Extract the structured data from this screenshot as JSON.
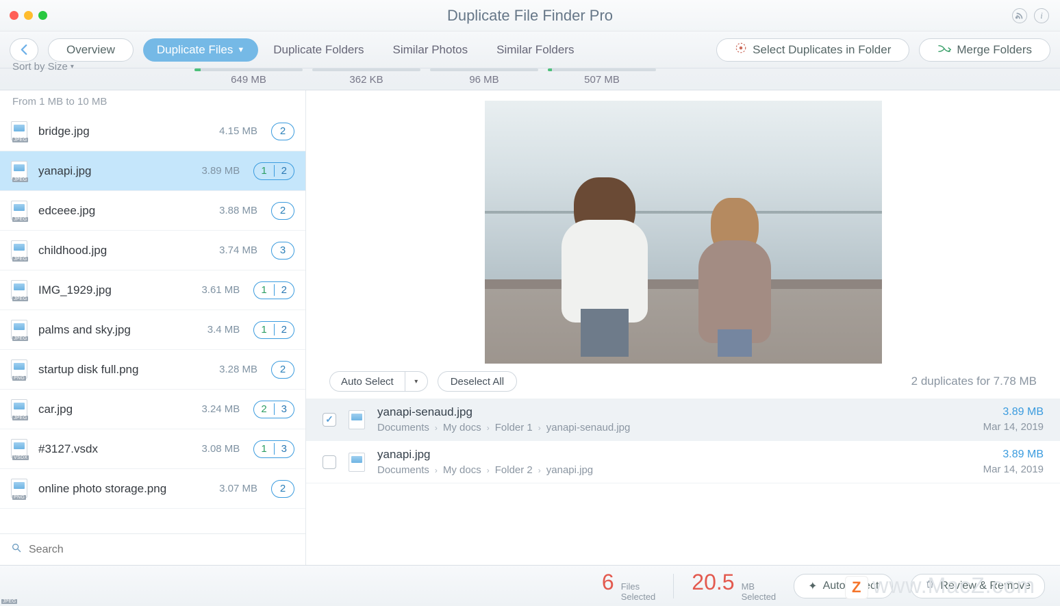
{
  "app": {
    "title": "Duplicate File Finder Pro"
  },
  "toolbar": {
    "overview": "Overview",
    "select_folder": "Select Duplicates in Folder",
    "merge": "Merge Folders"
  },
  "tabs": [
    {
      "label": "Duplicate Files",
      "size": "649 MB",
      "fill_pct": 6,
      "selected": true,
      "caret": true
    },
    {
      "label": "Duplicate Folders",
      "size": "362 KB",
      "fill_pct": 0
    },
    {
      "label": "Similar Photos",
      "size": "96 MB",
      "fill_pct": 0
    },
    {
      "label": "Similar Folders",
      "size": "507 MB",
      "fill_pct": 4
    }
  ],
  "sidebar": {
    "sort_label": "Sort by Size",
    "range": "From 1 MB to 10 MB",
    "search_placeholder": "Search",
    "items": [
      {
        "name": "bridge.jpg",
        "size": "4.15 MB",
        "badge": [
          "2"
        ],
        "ext": "JPEG"
      },
      {
        "name": "yanapi.jpg",
        "size": "3.89 MB",
        "badge": [
          "1",
          "2"
        ],
        "ext": "JPEG",
        "selected": true
      },
      {
        "name": "edceee.jpg",
        "size": "3.88 MB",
        "badge": [
          "2"
        ],
        "ext": "JPEG"
      },
      {
        "name": "childhood.jpg",
        "size": "3.74 MB",
        "badge": [
          "3"
        ],
        "ext": "JPEG"
      },
      {
        "name": "IMG_1929.jpg",
        "size": "3.61 MB",
        "badge": [
          "1",
          "2"
        ],
        "ext": "JPEG"
      },
      {
        "name": "palms and sky.jpg",
        "size": "3.4 MB",
        "badge": [
          "1",
          "2"
        ],
        "ext": "JPEG"
      },
      {
        "name": "startup disk full.png",
        "size": "3.28 MB",
        "badge": [
          "2"
        ],
        "ext": "PNG"
      },
      {
        "name": "car.jpg",
        "size": "3.24 MB",
        "badge": [
          "2",
          "3"
        ],
        "ext": "JPEG"
      },
      {
        "name": "#3127.vsdx",
        "size": "3.08 MB",
        "badge": [
          "1",
          "3"
        ],
        "ext": "VSDX"
      },
      {
        "name": "online photo storage.png",
        "size": "3.07 MB",
        "badge": [
          "2"
        ],
        "ext": "PNG"
      }
    ]
  },
  "detail": {
    "auto_select": "Auto Select",
    "deselect": "Deselect All",
    "summary": "2 duplicates for 7.78 MB",
    "rows": [
      {
        "checked": true,
        "name": "yanapi-senaud.jpg",
        "path": [
          "Documents",
          "My docs",
          "Folder 1",
          "yanapi-senaud.jpg"
        ],
        "size": "3.89 MB",
        "date": "Mar 14, 2019"
      },
      {
        "checked": false,
        "name": "yanapi.jpg",
        "path": [
          "Documents",
          "My docs",
          "Folder 2",
          "yanapi.jpg"
        ],
        "size": "3.89 MB",
        "date": "Mar 14, 2019"
      }
    ]
  },
  "footer": {
    "files_num": "6",
    "files_unit1": "Files",
    "files_unit2": "Selected",
    "mb_num": "20.5",
    "mb_unit1": "MB",
    "mb_unit2": "Selected",
    "auto_select": "Auto Select",
    "review": "Review & Remove"
  },
  "watermark": "www.MacZ.com"
}
